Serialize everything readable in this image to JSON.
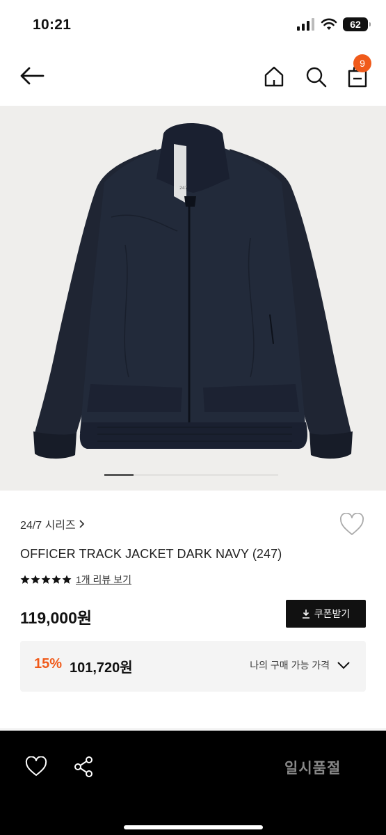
{
  "status_bar": {
    "time": "10:21",
    "battery": "62"
  },
  "header": {
    "cart_count": "9"
  },
  "product": {
    "series": "24/7 시리즈",
    "title": "OFFICER TRACK JACKET DARK NAVY (247)",
    "rating_stars": 5,
    "review_link": "1개 리뷰 보기",
    "price": "119,000원",
    "coupon_label": "쿠폰받기",
    "discount_rate": "15%",
    "discount_price": "101,720원",
    "discount_toggle_label": "나의 구매 가능 가격",
    "jacket_tag": "247"
  },
  "bottom_bar": {
    "soldout_label": "일시품절"
  },
  "colors": {
    "accent": "#f05a1a",
    "jacket": "#1f2533",
    "image_bg": "#efeeec"
  },
  "icons": [
    "back-arrow-icon",
    "home-icon",
    "search-icon",
    "shopping-bag-icon",
    "heart-icon",
    "star-icon",
    "download-icon",
    "chevron-down-icon",
    "chevron-right-icon",
    "share-icon"
  ]
}
